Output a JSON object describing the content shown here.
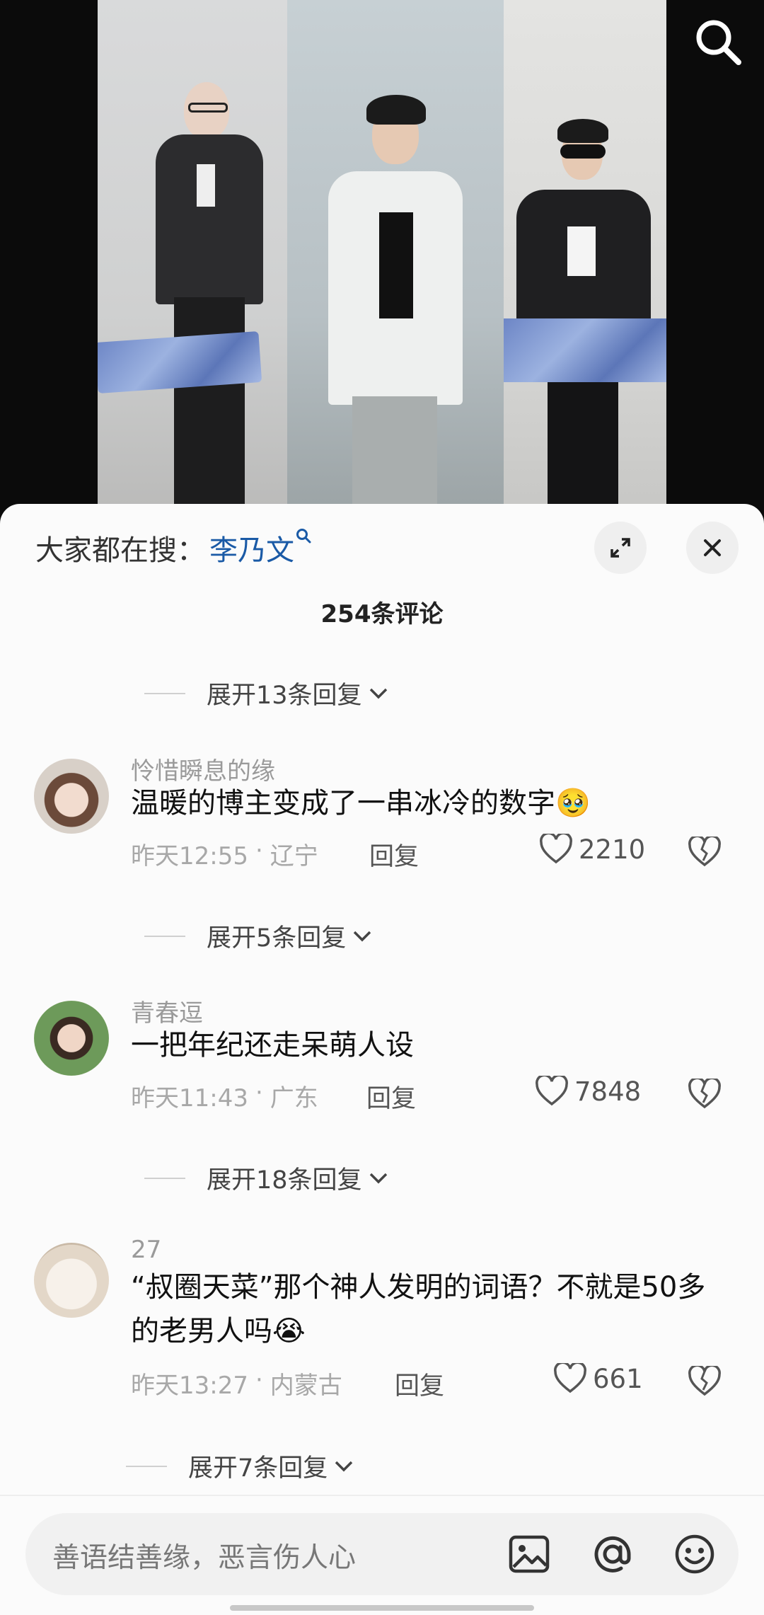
{
  "search_bar": {
    "prefix": "大家都在搜：",
    "keyword": "李乃文"
  },
  "comment_count": "254条评论",
  "top_expand": "展开13条回复",
  "comments": [
    {
      "username": "怜惜瞬息的缘",
      "text": "温暖的博主变成了一串冰冷的数字🥹",
      "time": "昨天12:55",
      "location": "辽宁",
      "reply": "回复",
      "likes": "2210",
      "expand": "展开5条回复"
    },
    {
      "username": "青春逗",
      "text": "一把年纪还走呆萌人设",
      "time": "昨天11:43",
      "location": "广东",
      "reply": "回复",
      "likes": "7848",
      "expand": "展开18条回复"
    },
    {
      "username": "27",
      "text": "“叔圈天菜”那个神人发明的词语？不就是50多的老男人吗😭",
      "time": "昨天13:27",
      "location": "内蒙古",
      "reply": "回复",
      "likes": "661",
      "expand": "展开7条回复"
    }
  ],
  "input": {
    "placeholder": "善语结善缘，恶言伤人心"
  },
  "icons": [
    "search-icon",
    "expand-icon",
    "close-icon",
    "heart-icon",
    "broken-heart-icon",
    "chevron-down-icon",
    "image-icon",
    "at-icon",
    "emoji-icon"
  ],
  "colors": {
    "keyword": "#1a5aa6",
    "sheet_bg": "#fbfbfb",
    "muted_text": "#9a9a9a"
  }
}
